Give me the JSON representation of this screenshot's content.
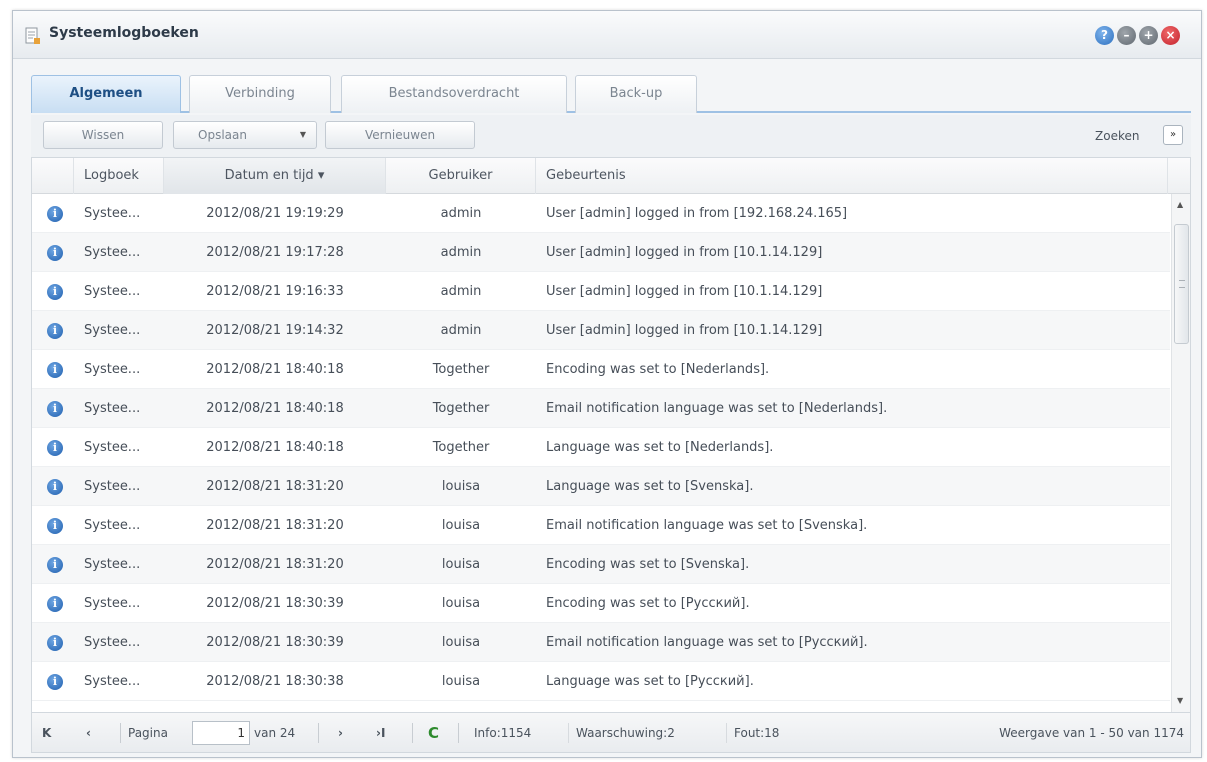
{
  "window": {
    "title": "Systeemlogboeken",
    "buttons": {
      "help": "?",
      "minimize": "–",
      "maximize": "+",
      "close": "×"
    }
  },
  "tabs": [
    {
      "label": "Algemeen",
      "active": true
    },
    {
      "label": "Verbinding",
      "active": false
    },
    {
      "label": "Bestandsoverdracht",
      "active": false
    },
    {
      "label": "Back-up",
      "active": false
    }
  ],
  "toolbar": {
    "clear_label": "Wissen",
    "save_label": "Opslaan",
    "refresh_label": "Vernieuwen",
    "search_label": "Zoeken"
  },
  "grid": {
    "columns": {
      "logboek": "Logboek",
      "datum": "Datum en tijd",
      "datum_sort": "▾",
      "gebruiker": "Gebruiker",
      "gebeurtenis": "Gebeurtenis"
    },
    "rows": [
      {
        "logboek": "Systee...",
        "datum": "2012/08/21 19:19:29",
        "gebruiker": "admin",
        "gebeurtenis": "User [admin] logged in from [192.168.24.165]"
      },
      {
        "logboek": "Systee...",
        "datum": "2012/08/21 19:17:28",
        "gebruiker": "admin",
        "gebeurtenis": "User [admin] logged in from [10.1.14.129]"
      },
      {
        "logboek": "Systee...",
        "datum": "2012/08/21 19:16:33",
        "gebruiker": "admin",
        "gebeurtenis": "User [admin] logged in from [10.1.14.129]"
      },
      {
        "logboek": "Systee...",
        "datum": "2012/08/21 19:14:32",
        "gebruiker": "admin",
        "gebeurtenis": "User [admin] logged in from [10.1.14.129]"
      },
      {
        "logboek": "Systee...",
        "datum": "2012/08/21 18:40:18",
        "gebruiker": "Together",
        "gebeurtenis": "Encoding was set to [Nederlands]."
      },
      {
        "logboek": "Systee...",
        "datum": "2012/08/21 18:40:18",
        "gebruiker": "Together",
        "gebeurtenis": "Email notification language was set to [Nederlands]."
      },
      {
        "logboek": "Systee...",
        "datum": "2012/08/21 18:40:18",
        "gebruiker": "Together",
        "gebeurtenis": "Language was set to [Nederlands]."
      },
      {
        "logboek": "Systee...",
        "datum": "2012/08/21 18:31:20",
        "gebruiker": "louisa",
        "gebeurtenis": "Language was set to [Svenska]."
      },
      {
        "logboek": "Systee...",
        "datum": "2012/08/21 18:31:20",
        "gebruiker": "louisa",
        "gebeurtenis": "Email notification language was set to [Svenska]."
      },
      {
        "logboek": "Systee...",
        "datum": "2012/08/21 18:31:20",
        "gebruiker": "louisa",
        "gebeurtenis": "Encoding was set to [Svenska]."
      },
      {
        "logboek": "Systee...",
        "datum": "2012/08/21 18:30:39",
        "gebruiker": "louisa",
        "gebeurtenis": "Encoding was set to [Русский]."
      },
      {
        "logboek": "Systee...",
        "datum": "2012/08/21 18:30:39",
        "gebruiker": "louisa",
        "gebeurtenis": "Email notification language was set to [Русский]."
      },
      {
        "logboek": "Systee...",
        "datum": "2012/08/21 18:30:38",
        "gebruiker": "louisa",
        "gebeurtenis": "Language was set to [Русский]."
      }
    ]
  },
  "pager": {
    "first_icon": "K",
    "prev_icon": "‹",
    "next_icon": "›",
    "last_icon": "›I",
    "refresh_icon": "C",
    "page_label": "Pagina",
    "page_value": "1",
    "of_label": "van 24",
    "info": "Info:1154",
    "warning": "Waarschuwing:2",
    "error": "Fout:18",
    "display": "Weergave van 1 - 50 van 1174"
  },
  "colors": {
    "accent": "#1e4f84",
    "info_icon": "#1f5fae",
    "refresh": "#2e8b2e",
    "close": "#c3212c"
  }
}
